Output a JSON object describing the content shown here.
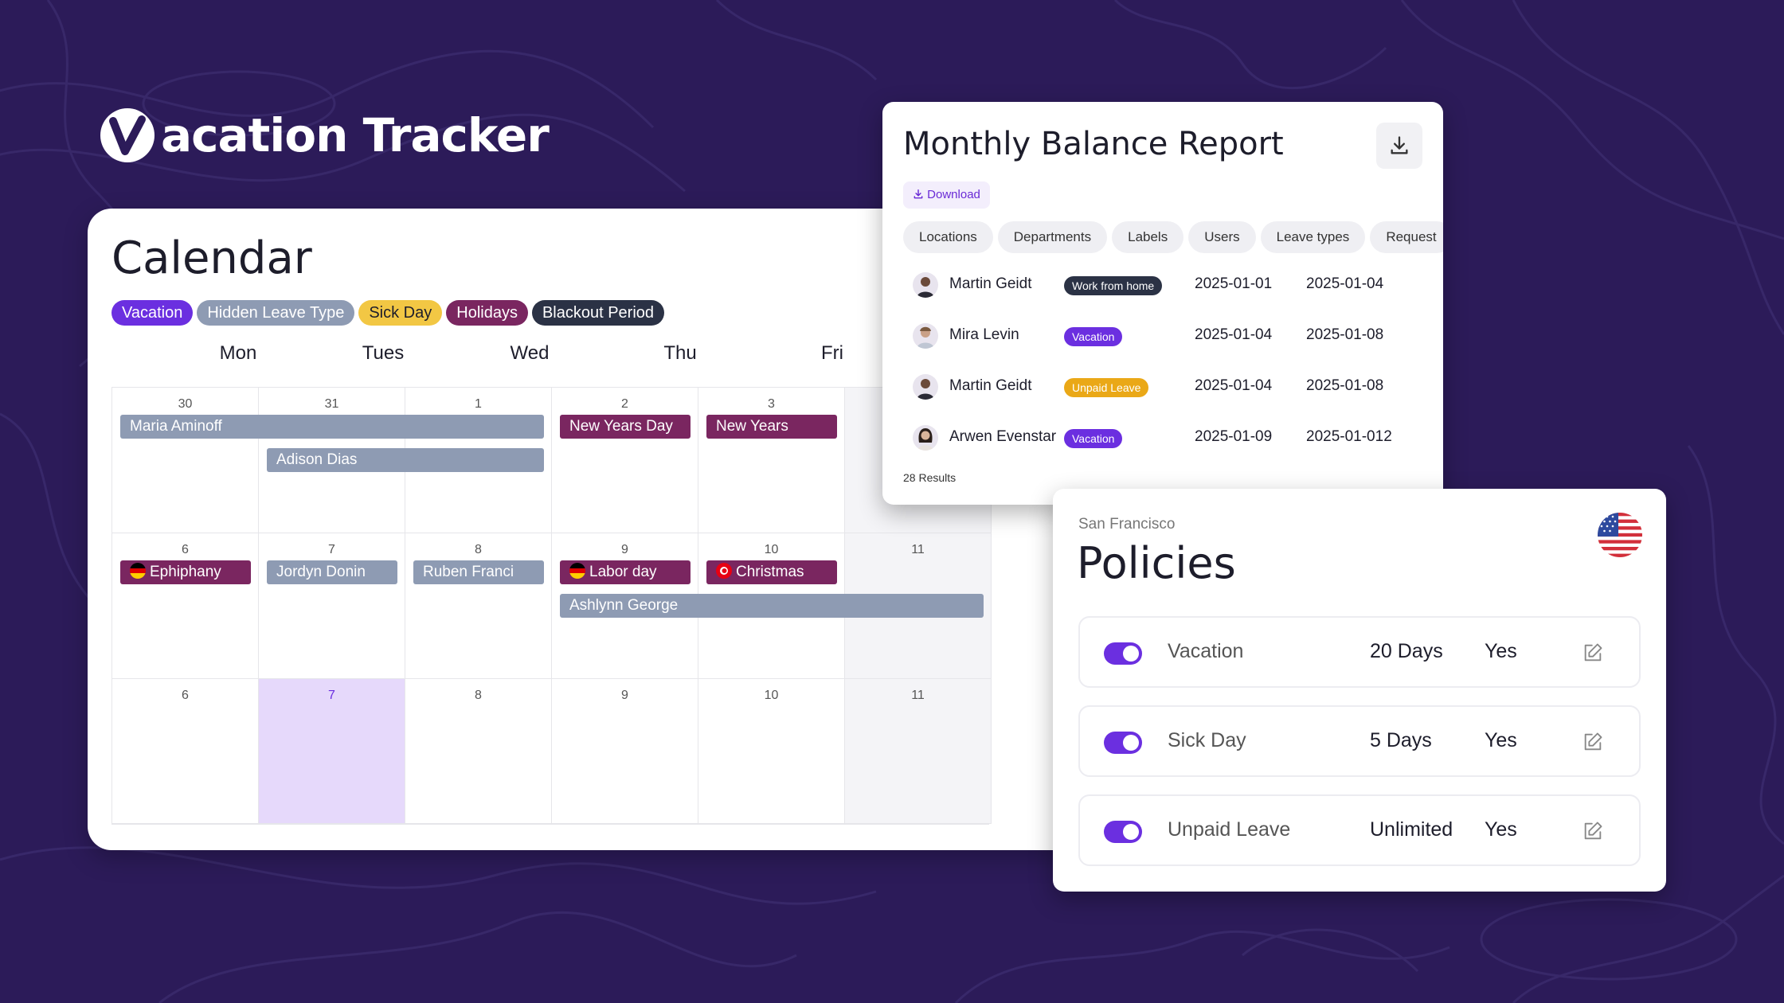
{
  "brand": {
    "name": "acation Tracker",
    "logo_letter": "V",
    "bg_color": "#2c1b59"
  },
  "calendar": {
    "title": "Calendar",
    "legend": [
      {
        "label": "Vacation",
        "color": "#6b2fe0",
        "text_color": "#ffffff"
      },
      {
        "label": "Hidden Leave Type",
        "color": "#8e9bb3",
        "text_color": "#ffffff"
      },
      {
        "label": "Sick Day",
        "color": "#f2c744",
        "text_color": "#1d1d2b"
      },
      {
        "label": "Holidays",
        "color": "#7a2660",
        "text_color": "#ffffff"
      },
      {
        "label": "Blackout Period",
        "color": "#2b3245",
        "text_color": "#ffffff"
      }
    ],
    "weekdays": [
      "Mon",
      "Tues",
      "Wed",
      "Thu",
      "Fri"
    ],
    "weeks": [
      [
        "30",
        "31",
        "1",
        "2",
        "3",
        ""
      ],
      [
        "6",
        "7",
        "8",
        "9",
        "10",
        "11"
      ],
      [
        "6",
        "7",
        "8",
        "9",
        "10",
        "11"
      ]
    ],
    "events": {
      "maria": "Maria Aminoff",
      "adison": "Adison Dias",
      "new_years_day": "New Years Day",
      "new_years": "New Years",
      "ephiphany": "Ephiphany",
      "jordyn": "Jordyn Donin",
      "ruben": "Ruben Franci",
      "labor_day": "Labor day",
      "christmas": "Christmas",
      "ashlynn": "Ashlynn George"
    },
    "today_color": "#e6d9fb"
  },
  "report": {
    "title": "Monthly Balance Report",
    "download_label": "Download",
    "tabs": [
      "Locations",
      "Departments",
      "Labels",
      "Users",
      "Leave types",
      "Request"
    ],
    "rows": [
      {
        "name": "Martin Geidt",
        "type": "Work from home",
        "type_color": "#2b3245",
        "start": "2025-01-01",
        "end": "2025-01-04"
      },
      {
        "name": "Mira Levin",
        "type": "Vacation",
        "type_color": "#6b2fe0",
        "start": "2025-01-04",
        "end": "2025-01-08"
      },
      {
        "name": "Martin Geidt",
        "type": "Unpaid Leave",
        "type_color": "#eaa817",
        "start": "2025-01-04",
        "end": "2025-01-08"
      },
      {
        "name": "Arwen Evenstar",
        "type": "Vacation",
        "type_color": "#6b2fe0",
        "start": "2025-01-09",
        "end": "2025-01-012"
      }
    ],
    "results": "28 Results"
  },
  "policies": {
    "location": "San Francisco",
    "title": "Policies",
    "items": [
      {
        "name": "Vacation",
        "days": "20 Days",
        "enabled": "Yes"
      },
      {
        "name": "Sick Day",
        "days": "5 Days",
        "enabled": "Yes"
      },
      {
        "name": "Unpaid Leave",
        "days": "Unlimited",
        "enabled": "Yes"
      }
    ],
    "toggle_color": "#6b2fe0"
  }
}
